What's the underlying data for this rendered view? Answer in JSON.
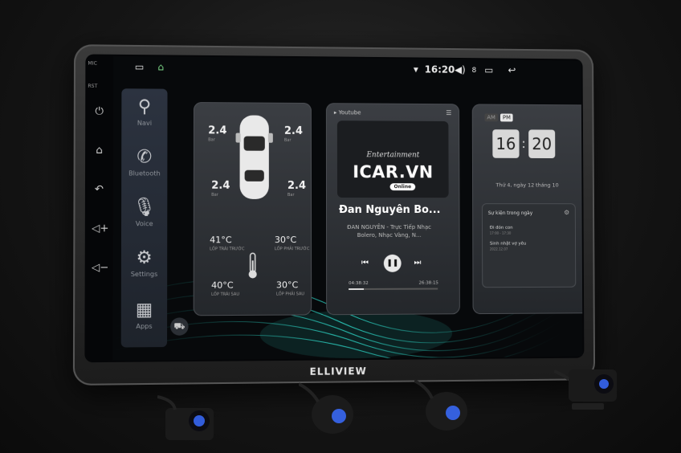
{
  "status_bar": {
    "time": "16:20",
    "volume": "8"
  },
  "side_panel": {
    "mic_label": "MIC",
    "rst_label": "RST"
  },
  "dock": [
    {
      "label": "Navi",
      "icon": "map-pin-icon"
    },
    {
      "label": "Bluetooth",
      "icon": "phone-icon"
    },
    {
      "label": "Voice",
      "icon": "microphone-icon"
    },
    {
      "label": "Settings",
      "icon": "gear-icon"
    },
    {
      "label": "Apps",
      "icon": "apps-grid-icon"
    }
  ],
  "tpms": {
    "fl": {
      "value": "2.4",
      "unit": "Bar"
    },
    "fr": {
      "value": "2.4",
      "unit": "Bar"
    },
    "rl": {
      "value": "2.4",
      "unit": "Bar"
    },
    "rr": {
      "value": "2.4",
      "unit": "Bar"
    },
    "temp_fl": {
      "value": "41°C",
      "label": "LỐP TRÁI TRƯỚC"
    },
    "temp_fr": {
      "value": "30°C",
      "label": "LỐP PHẢI TRƯỚC"
    },
    "temp_rl": {
      "value": "40°C",
      "label": "LỐP TRÁI SAU"
    },
    "temp_rr": {
      "value": "30°C",
      "label": "LỐP PHẢI SAU"
    }
  },
  "player": {
    "source": "Youtube",
    "brand_top": "Entertainment",
    "brand": "ICAR.VN",
    "brand_badge": "Online",
    "song": "Đan Nguyên Bo...",
    "artist": "ĐAN NGUYÊN - Trực Tiếp Nhạc Bolero, Nhạc Vàng, N...",
    "time_current": "04:38:32",
    "time_total": "26:38:15",
    "progress": 0.17
  },
  "clock": {
    "am": "AM",
    "pm": "PM",
    "hour": "16",
    "minute": "20",
    "date": "Thứ 4, ngày 12 tháng 10",
    "events_title": "Sự kiện trong ngày",
    "events": [
      {
        "title": "Đi đón con",
        "time": "17:00 - 17:30"
      },
      {
        "title": "Sinh nhật vợ yêu",
        "time": "2022.12.07"
      }
    ]
  },
  "brand_name": "ELLIVIEW",
  "colors": {
    "accent": "#2fe0d0",
    "camera_glow": "#3a6cff"
  }
}
